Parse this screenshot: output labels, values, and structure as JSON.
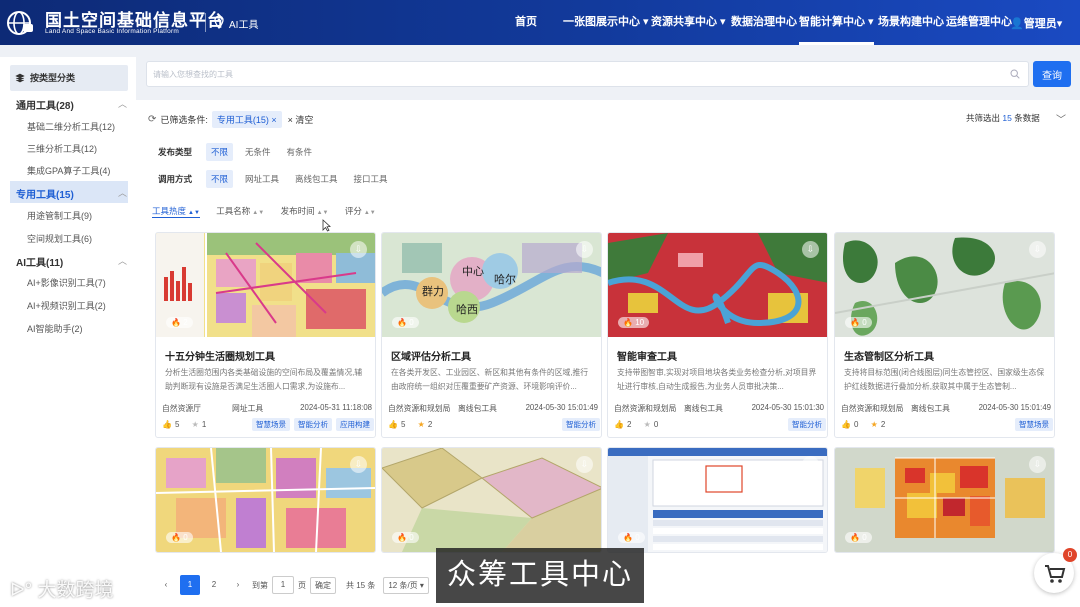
{
  "header": {
    "title": "国土空间基础信息平台",
    "subtitle": "Land And Space Basic Information Platform",
    "location": "AI工具",
    "nav": [
      {
        "label": "首页"
      },
      {
        "label": "一张图展示中心 ▾"
      },
      {
        "label": "资源共享中心 ▾"
      },
      {
        "label": "数据治理中心"
      },
      {
        "label": "智能计算中心 ▾"
      },
      {
        "label": "场景构建中心"
      },
      {
        "label": "运维管理中心"
      }
    ],
    "user": "管理员▾"
  },
  "sidebar": {
    "heading": "按类型分类",
    "groups": [
      {
        "label": "通用工具(28)",
        "items": [
          "基础二维分析工具(12)",
          "三维分析工具(12)",
          "集成GPA算子工具(4)"
        ]
      },
      {
        "label": "专用工具(15)",
        "items": [
          "用途管制工具(9)",
          "空间规划工具(6)"
        ]
      },
      {
        "label": "AI工具(11)",
        "items": [
          "AI+影像识别工具(7)",
          "AI+视频识别工具(2)",
          "AI智能助手(2)"
        ]
      }
    ]
  },
  "search": {
    "placeholder": "请输入您想查找的工具",
    "button": "查询"
  },
  "filters": {
    "label": "已筛选条件:",
    "tag": "专用工具(15) ×",
    "clear": "× 清空",
    "count_prefix": "共筛选出",
    "count": "15",
    "count_suffix": "条数据",
    "publish_label": "发布类型",
    "publish_options": [
      "不限",
      "无条件",
      "有条件"
    ],
    "call_label": "调用方式",
    "call_options": [
      "不限",
      "网址工具",
      "离线包工具",
      "接口工具"
    ]
  },
  "sort": [
    "工具热度",
    "工具名称",
    "发布时间",
    "评分"
  ],
  "cards": [
    {
      "title": "十五分钟生活圈规划工具",
      "desc": "分析生活圈范围内各类基础设施的空间布局及覆盖情况,辅助判断现有设施是否满足生活圈人口需求,为设施布...",
      "org": "自然资源厅",
      "type": "网址工具",
      "date": "2024-05-31 11:18:08",
      "heat": "2",
      "likes": "5",
      "stars": "1",
      "tags": [
        "智慧场景",
        "智能分析",
        "应用构建"
      ]
    },
    {
      "title": "区域评估分析工具",
      "desc": "在各类开发区、工业园区、新区和其他有条件的区域,推行由政府统一组织对压覆重要矿产资源、环境影响评价...",
      "org": "自然资源和规划局",
      "type": "离线包工具",
      "date": "2024-05-30 15:01:49",
      "heat": "0",
      "likes": "5",
      "stars": "2",
      "tags": [
        "智能分析"
      ]
    },
    {
      "title": "智能审查工具",
      "desc": "支持带图智审,实现对项目地块各类业务检查分析,对项目界址进行审核,自动生成报告,为业务人员审批决策...",
      "org": "自然资源和规划局",
      "type": "离线包工具",
      "date": "2024-05-30 15:01:30",
      "heat": "10",
      "likes": "2",
      "stars": "0",
      "tags": [
        "智能分析"
      ]
    },
    {
      "title": "生态管制区分析工具",
      "desc": "支持将目标范围(闭合线图层)同生态管控区、国家级生态保护红线数据进行叠加分析,获取其中属于生态管制...",
      "org": "自然资源和规划局",
      "type": "离线包工具",
      "date": "2024-05-30 15:01:49",
      "heat": "0",
      "likes": "0",
      "stars": "2",
      "tags": [
        "智慧场景"
      ]
    },
    {
      "heat": "0"
    },
    {
      "heat": "0"
    },
    {
      "heat": "0"
    },
    {
      "heat": "0"
    }
  ],
  "pager": {
    "pages": [
      "1",
      "2"
    ],
    "goto_label": "到第",
    "goto_value": "1",
    "page_unit": "页",
    "confirm": "确定",
    "total": "共 15 条",
    "size": "12 条/页 ▾"
  },
  "overlay": {
    "caption": "众筹工具中心",
    "watermark": "大数跨境",
    "cart_count": "0"
  },
  "colors": {
    "header": "#123a9c",
    "accent": "#1f6ff0",
    "tag_bg": "#e5edfb"
  }
}
